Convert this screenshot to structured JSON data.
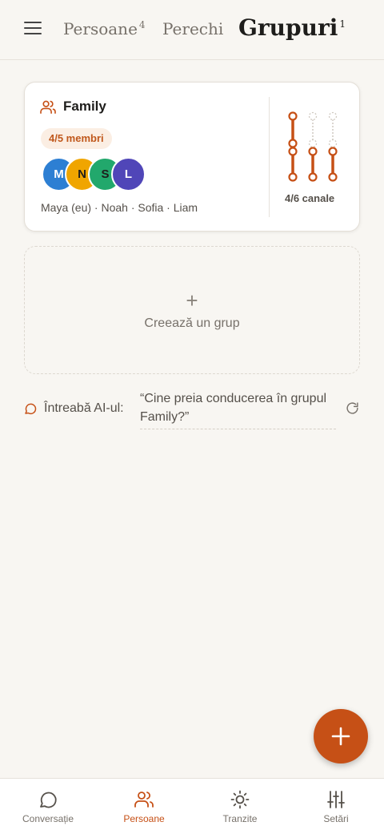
{
  "header": {
    "tabs": [
      {
        "label": "Persoane",
        "count": "4"
      },
      {
        "label": "Perechi",
        "count": ""
      },
      {
        "label": "Grupuri",
        "count": "1"
      }
    ],
    "active_tab": "Grupuri"
  },
  "group_card": {
    "name": "Family",
    "members_badge": "4/5 membri",
    "avatars": [
      {
        "initial": "M",
        "color": "#2d7fd3"
      },
      {
        "initial": "N",
        "color": "#f0a500"
      },
      {
        "initial": "S",
        "color": "#22a86c"
      },
      {
        "initial": "L",
        "color": "#5046b8"
      }
    ],
    "members_text": "Maya (eu) · Noah · Sofia · Liam",
    "channels_label": "4/6 canale",
    "channels_active": 4,
    "channels_total": 6
  },
  "create_group": {
    "plus": "+",
    "label": "Creează un grup"
  },
  "ask_ai": {
    "label": "Întreabă AI-ul:",
    "question": "“Cine preia conducerea în grupul Family?”"
  },
  "bottom_nav": [
    {
      "label": "Conversație",
      "icon": "chat-icon"
    },
    {
      "label": "Persoane",
      "icon": "people-icon"
    },
    {
      "label": "Tranzite",
      "icon": "sun-icon"
    },
    {
      "label": "Setări",
      "icon": "sliders-icon"
    }
  ],
  "active_nav": "Persoane",
  "colors": {
    "accent": "#c65016",
    "background": "#f8f6f2"
  }
}
